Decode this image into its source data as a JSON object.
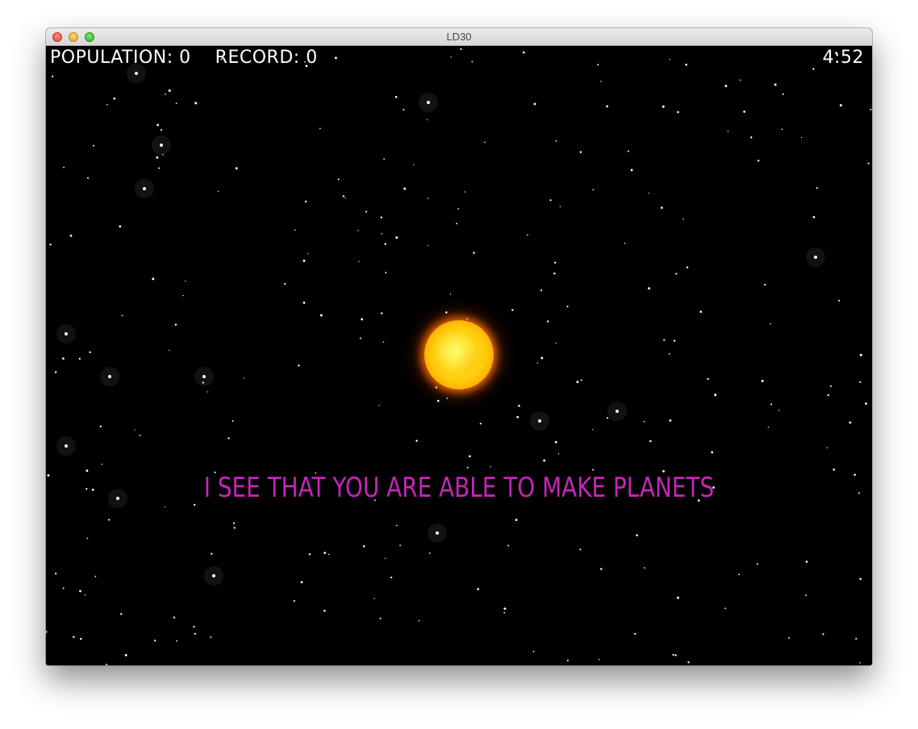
{
  "window": {
    "title": "LD30"
  },
  "hud": {
    "population_label": "POPULATION:",
    "population_value": "0",
    "record_label": "RECORD:",
    "record_value": "0",
    "timer": "4:52"
  },
  "message": {
    "text": "I SEE THAT YOU ARE ABLE TO MAKE PLANETS",
    "color": "#c526b7"
  },
  "colors": {
    "background": "#000000",
    "star": "#ffffff",
    "sun_core": "#ffe52a",
    "sun_edge": "#ff7a00"
  },
  "icons": {
    "close": "close-traffic-light-icon",
    "minimize": "minimize-traffic-light-icon",
    "maximize": "maximize-traffic-light-icon"
  }
}
